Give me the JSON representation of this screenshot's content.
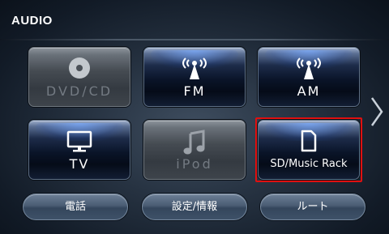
{
  "header": {
    "title": "AUDIO"
  },
  "sources": [
    {
      "label": "DVD/CD",
      "icon": "disc-icon",
      "state": "disabled"
    },
    {
      "label": "FM",
      "icon": "antenna-icon",
      "state": "active"
    },
    {
      "label": "AM",
      "icon": "antenna-icon",
      "state": "active"
    },
    {
      "label": "TV",
      "icon": "tv-icon",
      "state": "active"
    },
    {
      "label": "iPod",
      "icon": "music-note-icon",
      "state": "disabled"
    },
    {
      "label": "SD/Music Rack",
      "icon": "sd-card-icon",
      "state": "active",
      "highlighted": true
    }
  ],
  "bottom_buttons": [
    {
      "label": "電話"
    },
    {
      "label": "設定/情報"
    },
    {
      "label": "ルート"
    }
  ],
  "navigation": {
    "next_page_icon": "chevron-right-icon"
  },
  "colors": {
    "highlight": "#e01010",
    "active_glow": "#3a6fd8",
    "disabled_text": "#737a82"
  }
}
